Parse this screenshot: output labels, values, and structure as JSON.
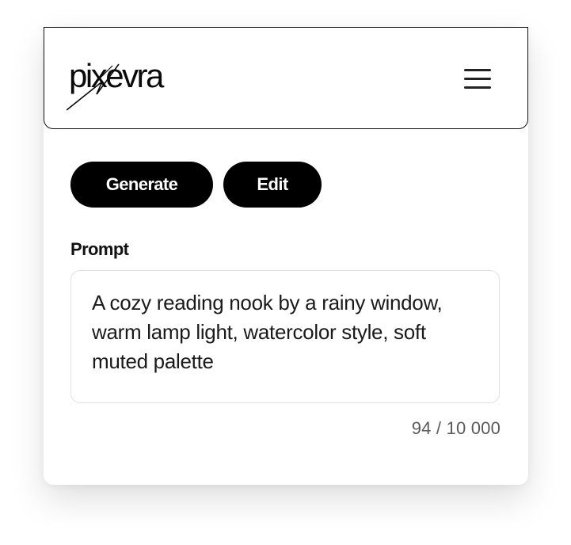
{
  "app": {
    "logo_text": "pixevra"
  },
  "header": {
    "menu_icon": "hamburger-menu-icon"
  },
  "modes": {
    "generate_label": "Generate",
    "edit_label": "Edit"
  },
  "prompt": {
    "label": "Prompt",
    "value": "A cozy reading nook by a rainy window, warm lamp light, watercolor style, soft muted palette",
    "char_count": "94 / 10 000"
  },
  "colors": {
    "primary_button": "#000000",
    "primary_button_text": "#ffffff",
    "border": "#e2e2e2"
  }
}
